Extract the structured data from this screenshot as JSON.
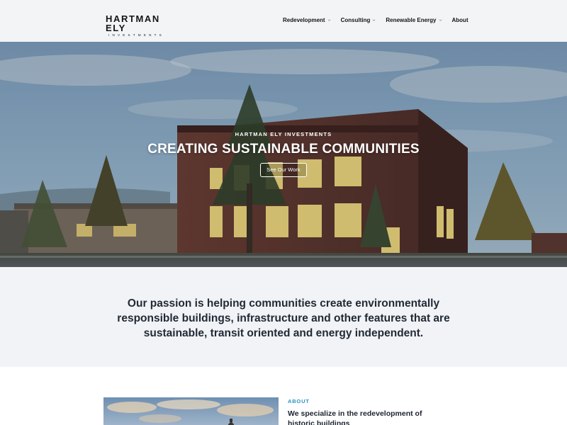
{
  "brand": {
    "name": "HARTMAN ELY",
    "tagline": "INVESTMENTS"
  },
  "nav": {
    "items": [
      {
        "label": "Redevelopment",
        "has_dropdown": true
      },
      {
        "label": "Consulting",
        "has_dropdown": true
      },
      {
        "label": "Renewable Energy",
        "has_dropdown": true
      },
      {
        "label": "About",
        "has_dropdown": false
      }
    ]
  },
  "hero": {
    "eyebrow": "HARTMAN ELY INVESTMENTS",
    "headline": "CREATING SUSTAINABLE COMMUNITIES",
    "cta_label": "See Our Work"
  },
  "mission": {
    "text": "Our passion is helping communities create environmentally responsible buildings, infrastructure and other features that are sustainable, transit oriented and energy independent."
  },
  "about": {
    "label": "ABOUT",
    "heading": "We specialize in the redevelopment of historic buildings"
  },
  "colors": {
    "accent": "#2c93c4",
    "header_bg": "#f3f4f6",
    "section_bg": "#f1f3f7",
    "text_dark": "#1f2630"
  }
}
